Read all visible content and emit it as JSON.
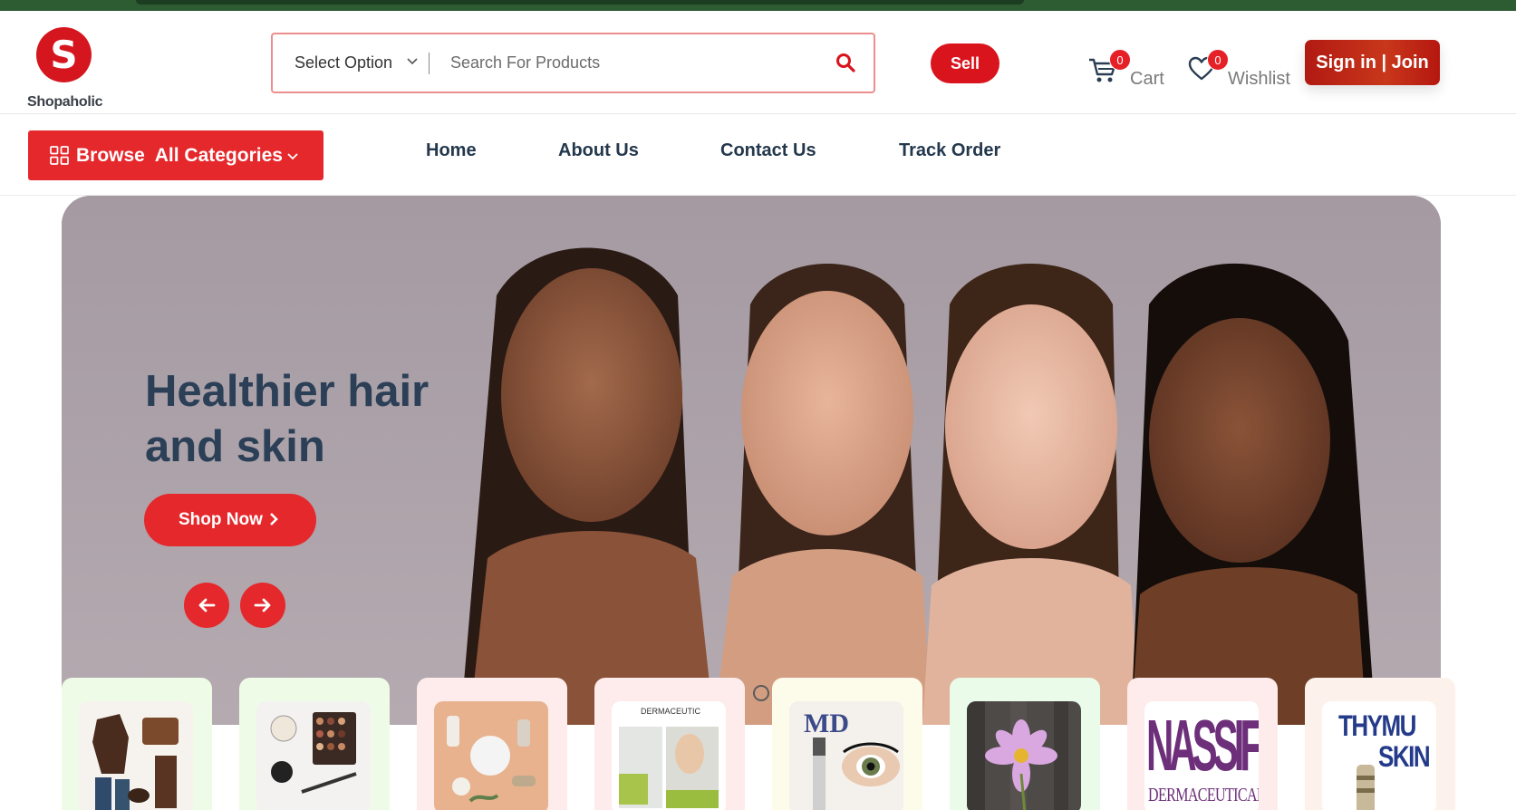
{
  "brand": {
    "logo_letter": "S",
    "name": "Shopaholic",
    "accent": "#d9141d"
  },
  "search": {
    "select_label": "Select Option",
    "placeholder": "Search For Products",
    "icon": "search-icon"
  },
  "header": {
    "sell_label": "Sell",
    "cart": {
      "label": "Cart",
      "count": "0",
      "icon": "cart-icon"
    },
    "wishlist": {
      "label": "Wishlist",
      "count": "0",
      "icon": "heart-icon"
    },
    "signin_label": "Sign in | Join"
  },
  "nav": {
    "browse_label": "Browse  All Categories",
    "items": [
      {
        "label": "Home"
      },
      {
        "label": "About Us"
      },
      {
        "label": "Contact Us"
      },
      {
        "label": "Track Order"
      }
    ]
  },
  "hero": {
    "title": "Healthier hair and skin",
    "cta_label": "Shop Now",
    "prev_icon": "arrow-left-icon",
    "next_icon": "arrow-right-icon"
  },
  "categories": {
    "card_colors": [
      "#eefbe7",
      "#eefbe7",
      "#fdeceb",
      "#fdeceb",
      "#fdfbe9",
      "#eafbe9",
      "#fdeceb",
      "#fdf1ec"
    ],
    "items": [
      {
        "name": "fashion"
      },
      {
        "name": "makeup"
      },
      {
        "name": "skincare"
      },
      {
        "name": "dermaceutic",
        "brand_text": "DERMACEUTIC"
      },
      {
        "name": "lash",
        "brand_text": "MD"
      },
      {
        "name": "flower"
      },
      {
        "name": "nassif",
        "brand_text": "NASSIFMD",
        "sub_text": "DERMACEUTICALS"
      },
      {
        "name": "thymu",
        "brand_text": "THYMU",
        "sub_text": "SKIN"
      }
    ]
  }
}
